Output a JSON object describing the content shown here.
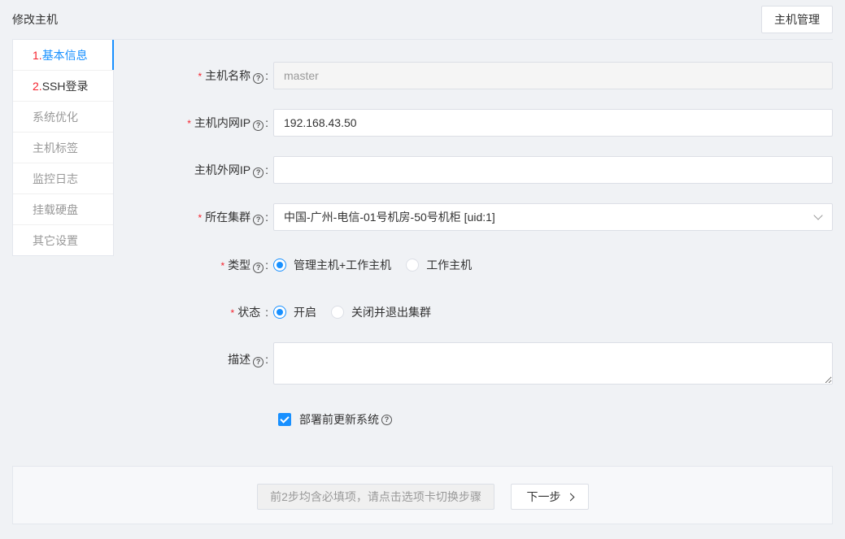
{
  "header": {
    "title": "修改主机",
    "manage_button": "主机管理"
  },
  "steps": [
    {
      "num": "1.",
      "label": "基本信息"
    },
    {
      "num": "2.",
      "label": "SSH登录"
    },
    {
      "label": "系统优化"
    },
    {
      "label": "主机标签"
    },
    {
      "label": "监控日志"
    },
    {
      "label": "挂载硬盘"
    },
    {
      "label": "其它设置"
    }
  ],
  "form": {
    "hostname": {
      "label": "主机名称",
      "value": "master"
    },
    "internal_ip": {
      "label": "主机内网IP",
      "value": "192.168.43.50"
    },
    "external_ip": {
      "label": "主机外网IP",
      "value": ""
    },
    "cluster": {
      "label": "所在集群",
      "value": "中国-广州-电信-01号机房-50号机柜 [uid:1]"
    },
    "type": {
      "label": "类型",
      "options": [
        "管理主机+工作主机",
        "工作主机"
      ],
      "selected": "管理主机+工作主机"
    },
    "status": {
      "label": "状态",
      "options": [
        "开启",
        "关闭并退出集群"
      ],
      "selected": "开启"
    },
    "description": {
      "label": "描述",
      "value": ""
    },
    "update_system": {
      "label": "部署前更新系统",
      "checked": true
    }
  },
  "footer": {
    "hint": "前2步均含必填项，请点击选项卡切换步骤",
    "next_button": "下一步"
  },
  "colors": {
    "accent": "#1890ff",
    "required": "#f5222d"
  }
}
